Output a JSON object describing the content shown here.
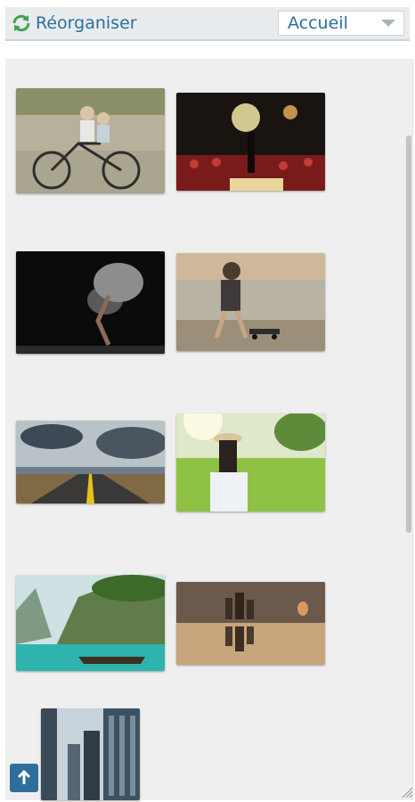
{
  "toolbar": {
    "reorganize_label": "Réorganiser",
    "page_select_value": "Accueil"
  },
  "colors": {
    "accent": "#2a6f9b",
    "panel_bg": "#efefef",
    "toolbar_bg": "#e8ecef",
    "up_button_bg": "#2f6e9b"
  },
  "icons": {
    "reorganize": "refresh-arrows-icon",
    "dropdown": "chevron-down-icon",
    "scroll_top": "arrow-up-icon",
    "resize": "resize-grip-icon"
  },
  "gallery": {
    "images": [
      "wall-mural-children-bicycle",
      "concert-crowd-stage",
      "dancer-flour-dust",
      "woman-skateboard-beach",
      "road-storm-clouds",
      "woman-hat-sunny-meadow",
      "tropical-cliffs-boat",
      "surreal-floating-city",
      "skyscrapers-looking-up"
    ]
  }
}
